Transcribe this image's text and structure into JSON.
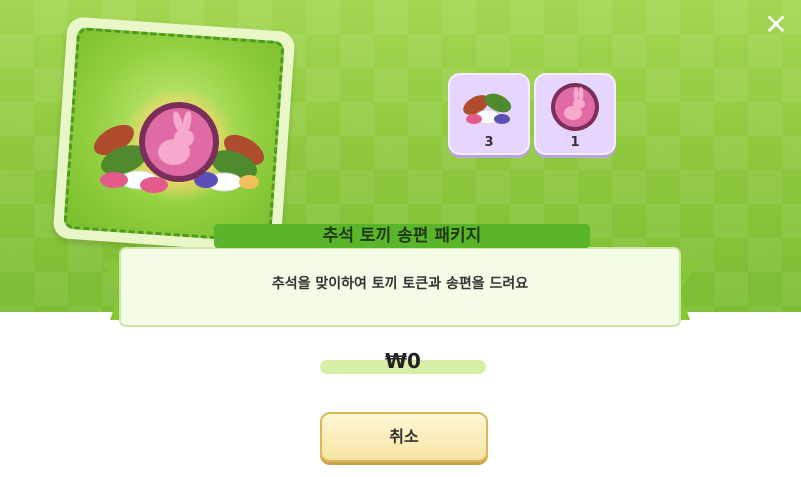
{
  "dialog": {
    "close_symbol": "✕",
    "package_title": "추석 토끼 송편 패키지",
    "description": "추석을 맞이하여 토끼 토큰과 송편을 드려요",
    "price": "₩0",
    "cancel_label": "취소"
  },
  "items": [
    {
      "icon": "songpyeon-icon",
      "count": "3"
    },
    {
      "icon": "rabbit-token-icon",
      "count": "1"
    }
  ],
  "colors": {
    "header_green": "#8cc63c",
    "title_bar": "#5bb52a",
    "token_pink": "#e06aa4",
    "button_yellow": "#f6e4a3"
  }
}
